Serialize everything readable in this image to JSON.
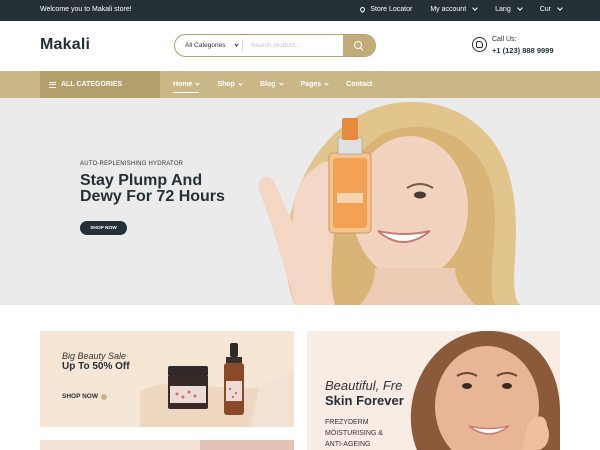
{
  "topbar": {
    "welcome": "Welcome you to Makali store!",
    "store_locator": "Store Locator",
    "account": "My account",
    "lang": "Lang",
    "currency": "Cur"
  },
  "header": {
    "logo": "Makali",
    "search": {
      "category": "All Categories",
      "placeholder": "Search product..."
    },
    "call": {
      "label": "Call Us:",
      "number": "+1 (123) 888 9999"
    }
  },
  "nav": {
    "all_categories": "ALL CATEGORIES",
    "items": [
      {
        "label": "Home"
      },
      {
        "label": "Shop"
      },
      {
        "label": "Blog"
      },
      {
        "label": "Pages"
      },
      {
        "label": "Contact"
      }
    ]
  },
  "hero": {
    "pre_title": "AUTO-REPLENISHING HYDRATOR",
    "title_line1": "Stay Plump And",
    "title_line2": "Dewy For 72 Hours",
    "cta": "SHOP NOW"
  },
  "banner_left": {
    "subtitle": "Big Beauty Sale",
    "title": "Up To 50% Off",
    "cta": "SHOP NOW"
  },
  "banner_right": {
    "subtitle": "Beautiful, Fre",
    "title": "Skin Forever",
    "desc_line1": "FREZYDERM",
    "desc_line2": "MOISTURISING &",
    "desc_line3": "ANTI-AGEING"
  },
  "colors": {
    "dark": "#253036",
    "gold": "#c9b787",
    "gold_dark": "#b29f6c",
    "hero_bg": "#ebebeb"
  }
}
